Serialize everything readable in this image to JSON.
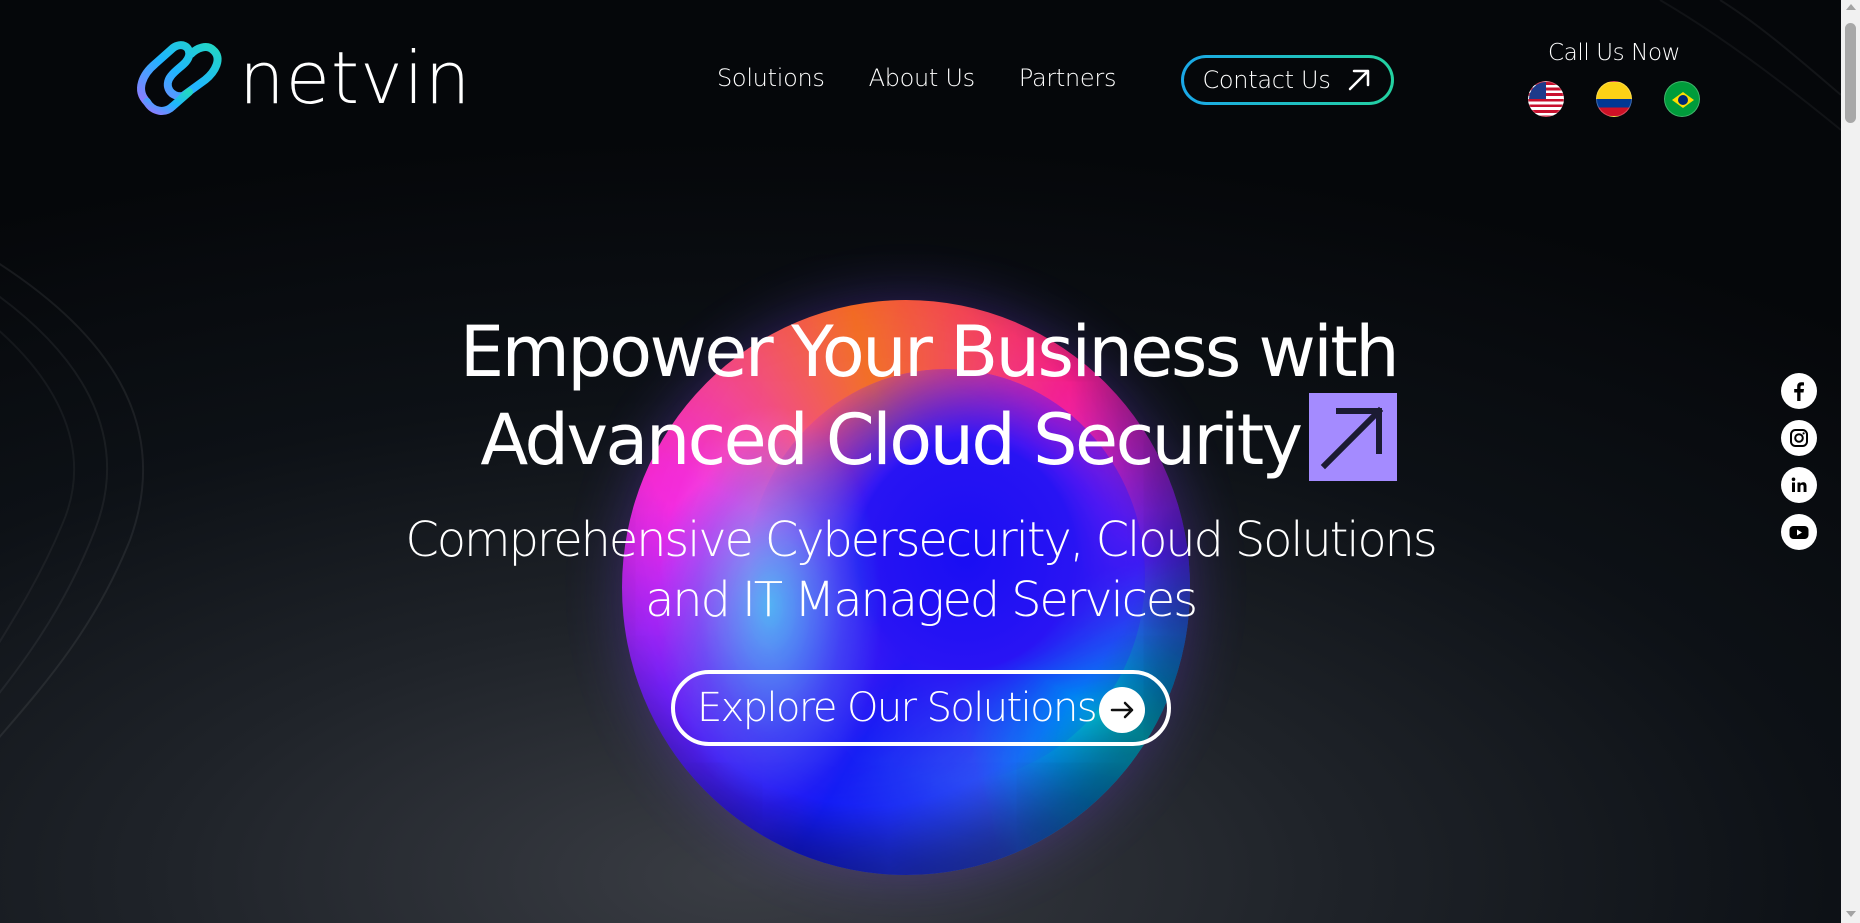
{
  "brand": {
    "name": "netvin",
    "logo_icon": "netvin-logo-icon"
  },
  "nav": {
    "links": [
      {
        "label": "Solutions"
      },
      {
        "label": "About Us"
      },
      {
        "label": "Partners"
      }
    ],
    "contact_label": "Contact Us",
    "contact_icon": "arrow-up-right-icon",
    "contact_border_colors": [
      "#1aa8e8",
      "#23d1a0"
    ]
  },
  "call": {
    "label": "Call Us Now",
    "flags": [
      {
        "icon": "us-flag-icon"
      },
      {
        "icon": "colombia-flag-icon"
      },
      {
        "icon": "brazil-flag-icon"
      }
    ]
  },
  "hero": {
    "headline_line1": "Empower Your Business with",
    "headline_line2": "Advanced Cloud Security",
    "headline_icon": "arrow-up-right-icon",
    "accent_color": "#a48bff",
    "subheadline_line1": "Comprehensive Cybersecurity, Cloud Solutions",
    "subheadline_line2": "and IT Managed Services",
    "cta_label": "Explore Our Solutions",
    "cta_icon": "arrow-right-icon"
  },
  "social": [
    {
      "icon": "facebook-icon"
    },
    {
      "icon": "instagram-icon"
    },
    {
      "icon": "linkedin-icon"
    },
    {
      "icon": "youtube-icon"
    }
  ]
}
